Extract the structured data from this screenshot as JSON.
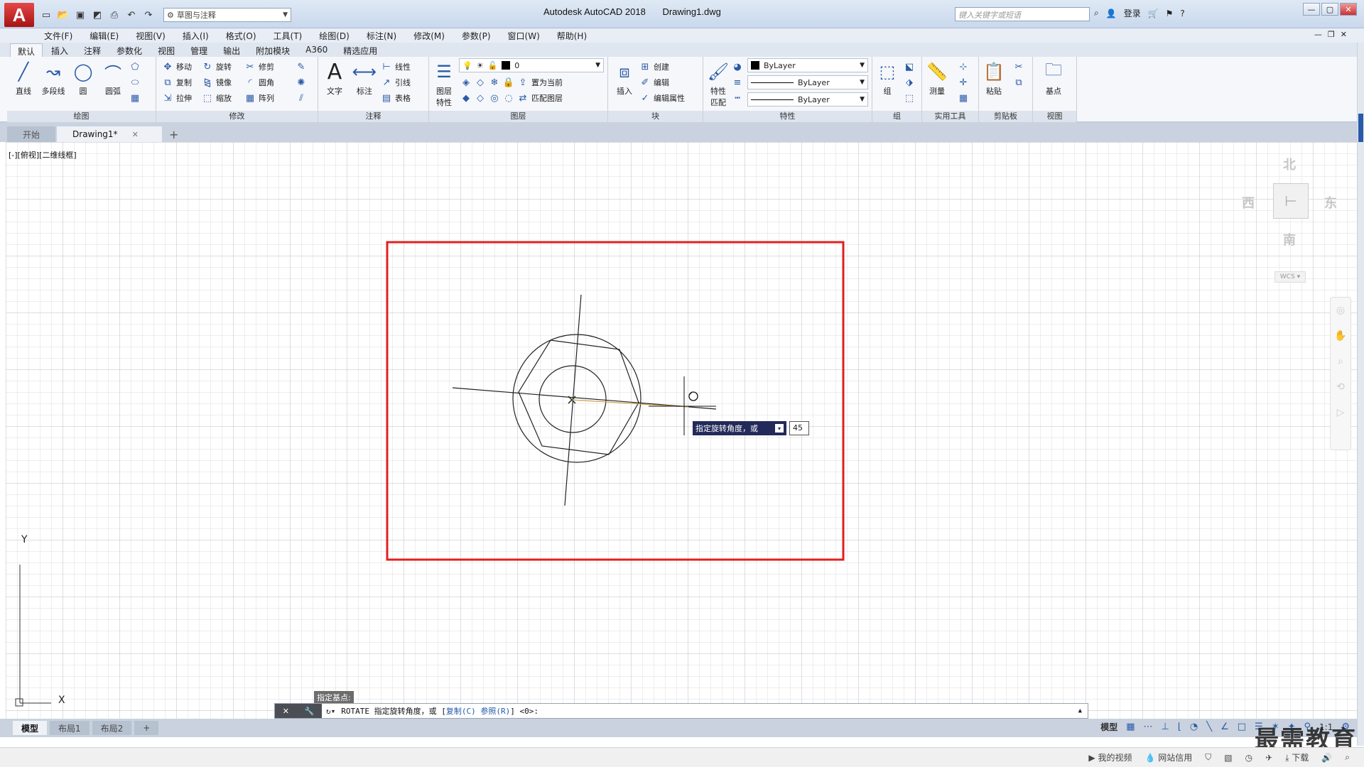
{
  "app": {
    "logo": "A",
    "title": "Autodesk AutoCAD 2018",
    "document": "Drawing1.dwg",
    "workspace": "草图与注释",
    "search_placeholder": "键入关键字或短语",
    "login": "登录"
  },
  "menu": [
    "文件(F)",
    "编辑(E)",
    "视图(V)",
    "插入(I)",
    "格式(O)",
    "工具(T)",
    "绘图(D)",
    "标注(N)",
    "修改(M)",
    "参数(P)",
    "窗口(W)",
    "帮助(H)"
  ],
  "ribbon_tabs": [
    "默认",
    "插入",
    "注释",
    "参数化",
    "视图",
    "管理",
    "输出",
    "附加模块",
    "A360",
    "精选应用"
  ],
  "ribbon": {
    "draw": {
      "title": "绘图",
      "line": "直线",
      "polyline": "多段线",
      "circle": "圆",
      "arc": "圆弧"
    },
    "modify": {
      "title": "修改",
      "move": "移动",
      "rotate": "旋转",
      "trim": "修剪",
      "copy": "复制",
      "mirror": "镜像",
      "fillet": "圆角",
      "stretch": "拉伸",
      "scale": "缩放",
      "array": "阵列"
    },
    "annotation": {
      "title": "注释",
      "text": "文字",
      "dimension": "标注",
      "linear": "线性",
      "leader": "引线",
      "table": "表格"
    },
    "layers": {
      "title": "图层",
      "props": "图层特性",
      "current_layer": "0",
      "set_current": "置为当前",
      "match_layer": "匹配图层"
    },
    "block": {
      "title": "块",
      "insert": "插入",
      "create": "创建",
      "edit": "编辑",
      "edit_attr": "编辑属性"
    },
    "properties": {
      "title": "特性",
      "match": "特性匹配",
      "color": "ByLayer",
      "lineweight": "ByLayer",
      "linetype": "ByLayer"
    },
    "groups": {
      "title": "组",
      "group": "组"
    },
    "utilities": {
      "title": "实用工具",
      "measure": "测量"
    },
    "clipboard": {
      "title": "剪贴板",
      "paste": "粘贴"
    },
    "view": {
      "title": "视图",
      "base": "基点"
    }
  },
  "file_tabs": [
    "开始",
    "Drawing1*"
  ],
  "viewport_label": "[-][俯视][二维线框]",
  "viewcube": {
    "north": "北",
    "south": "南",
    "east": "东",
    "west": "西",
    "wcs": "WCS"
  },
  "prompt": {
    "tooltip": "指定旋转角度，或",
    "input_value": "45",
    "base_point_tag": "指定基点:"
  },
  "command": {
    "name": "ROTATE",
    "text": "指定旋转角度，或 [",
    "opt_copy": "复制(C)",
    "opt_ref": "参照(R)",
    "tail": "] <0>:"
  },
  "ucs": {
    "x": "X",
    "y": "Y"
  },
  "layout_tabs": [
    "模型",
    "布局1",
    "布局2"
  ],
  "status": {
    "model": "模型",
    "scale": "1:1"
  },
  "taskbar": {
    "video": "我的视频",
    "network": "网站信用",
    "download": "下载"
  },
  "watermark": "最需教育",
  "colors": {
    "highlight_frame": "#e02020",
    "tooltip_bg": "#232a5a",
    "accent": "#2a5aa8"
  }
}
